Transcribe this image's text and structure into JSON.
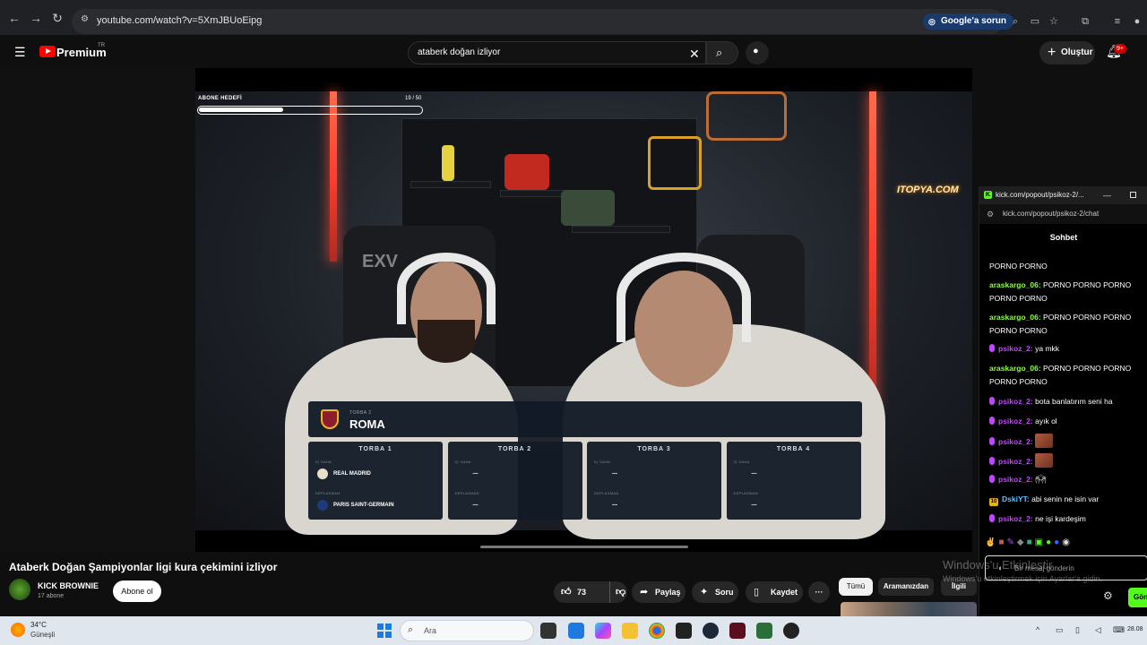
{
  "browser": {
    "url": "youtube.com/watch?v=5XmJBUoEipg",
    "google_button": "Google'a sorun"
  },
  "youtube": {
    "brand": "Premium",
    "region": "TR",
    "search_query": "ataberk doğan izliyor",
    "create_label": "Oluştur",
    "notification_count": "9+"
  },
  "stream_overlay": {
    "goal_label": "ABONE HEDEFİ",
    "goal_count": "19 / 50",
    "goal_progress": 0.38,
    "sponsor_logo": "ITOPYA.COM",
    "chair_brand": "EXV"
  },
  "draw": {
    "current_pot_label": "TORBA 2",
    "current_team": "ROMA",
    "pots": [
      {
        "title": "TORBA 1",
        "slot_labels": [
          "İÇ SAHA",
          "DEPLASMAN"
        ],
        "teams": [
          "REAL MADRID",
          "PARIS SAINT-GERMAIN"
        ]
      },
      {
        "title": "TORBA 2",
        "slot_labels": [
          "İÇ SAHA",
          "DEPLASMAN"
        ],
        "teams": [
          "—",
          "—"
        ]
      },
      {
        "title": "TORBA 3",
        "slot_labels": [
          "İÇ SAHA",
          "DEPLASMAN"
        ],
        "teams": [
          "—",
          "—"
        ]
      },
      {
        "title": "TORBA 4",
        "slot_labels": [
          "İÇ SAHA",
          "DEPLASMAN"
        ],
        "teams": [
          "—",
          "—"
        ]
      }
    ]
  },
  "video": {
    "title": "Ataberk Doğan Şampiyonlar ligi kura çekimini izliyor",
    "channel_name": "KICK BROWNIE",
    "subscribers": "17 abone",
    "subscribe_label": "Abone ol",
    "likes": "73",
    "share_label": "Paylaş",
    "ask_label": "Soru",
    "save_label": "Kaydet",
    "filters": [
      "Tümü",
      "Aramanızdan",
      "İlgili"
    ]
  },
  "kick": {
    "window_title": "kick.com/popout/psikoz-2/...",
    "url": "kick.com/popout/psikoz-2/chat",
    "chat_header": "Sohbet",
    "input_placeholder": "Bir mesaj gönderin",
    "send_label": "Gön",
    "messages": [
      {
        "user": "",
        "text": "PORNO PORNO",
        "color": "#ffffff",
        "badge": "none"
      },
      {
        "user": "araskargo_06:",
        "text": "PORNO PORNO PORNO",
        "color": "#8aff3c",
        "badge": "none"
      },
      {
        "user": "",
        "text": "PORNO PORNO",
        "color": "#ffffff",
        "badge": "none"
      },
      {
        "user": "araskargo_06:",
        "text": "PORNO PORNO PORNO",
        "color": "#8aff3c",
        "badge": "none"
      },
      {
        "user": "",
        "text": "PORNO PORNO",
        "color": "#ffffff",
        "badge": "none"
      },
      {
        "user": "psikoz_2:",
        "text": "ya mkk",
        "color": "#c246ff",
        "badge": "mic"
      },
      {
        "user": "araskargo_06:",
        "text": "PORNO PORNO PORNO",
        "color": "#8aff3c",
        "badge": "none"
      },
      {
        "user": "",
        "text": "PORNO PORNO",
        "color": "#ffffff",
        "badge": "none"
      },
      {
        "user": "psikoz_2:",
        "text": "bota banlatırım seni ha",
        "color": "#c246ff",
        "badge": "mic"
      },
      {
        "user": "psikoz_2:",
        "text": "ayık ol",
        "color": "#c246ff",
        "badge": "mic"
      },
      {
        "user": "psikoz_2:",
        "text": "",
        "color": "#c246ff",
        "badge": "mic",
        "emote": "face"
      },
      {
        "user": "psikoz_2:",
        "text": "",
        "color": "#c246ff",
        "badge": "mic",
        "emote": "face"
      },
      {
        "user": "psikoz_2:",
        "text": "",
        "color": "#c246ff",
        "badge": "mic",
        "emote": "hands"
      },
      {
        "user": "DskiYT:",
        "text": "abi senin ne isin var",
        "color": "#59c3ff",
        "badge": "sub"
      },
      {
        "user": "psikoz_2:",
        "text": "ne işi kardeşim",
        "color": "#c246ff",
        "badge": "mic"
      }
    ]
  },
  "watermark": {
    "line1": "Windows'u Etkinleştir",
    "line2": "Windows'u etkinleştirmek için Ayarlar'a gidin."
  },
  "taskbar": {
    "temperature": "34°C",
    "weather": "Güneşli",
    "search_placeholder": "Ara",
    "time": "28.08"
  }
}
